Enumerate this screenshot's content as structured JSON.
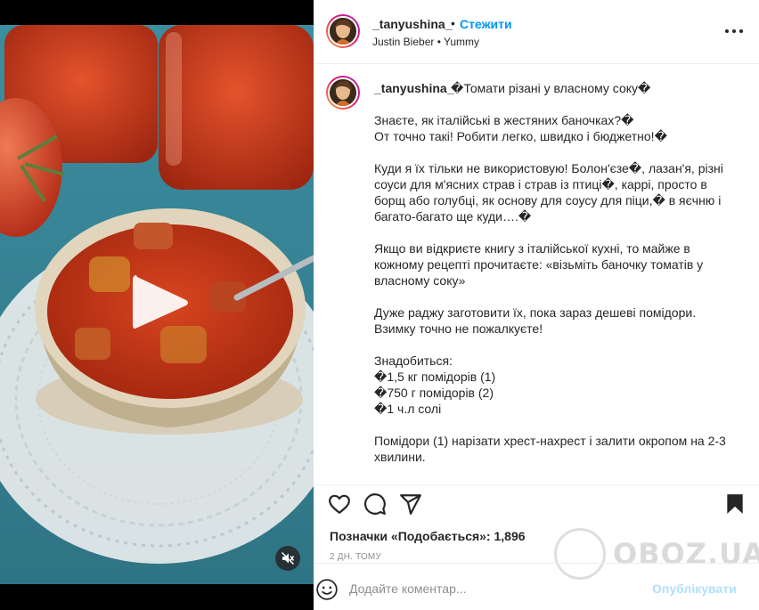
{
  "header": {
    "username": "_tanyushina_",
    "separator": "•",
    "follow_label": "Стежити",
    "audio": "Justin Bieber • Yummy",
    "more_icon": "more-horizontal-icon"
  },
  "caption": {
    "username": "_tanyushina_",
    "title": "�Томати різані у власному соку�",
    "lines": [
      "Знаєте, як італійські в жестяних баночках?�",
      "От точно такі! Робити легко, швидко і бюджетно!�",
      "",
      "Куди я їх тільки не використовую! Болон'єзе�, лазан'я, різні",
      "соуси для м'ясних страв і страв із птиці�, каррі, просто в",
      "борщ або голубці, як основу для соусу для піци,� в яєчню і",
      "багато-багато ще куди….�",
      "",
      "Якщо ви відкриєте книгу з італійської кухні, то майже в",
      "кожному рецепті прочитаєте: «візьміть баночку томатів у",
      "власному соку»",
      "",
      "Дуже раджу заготовити їх, пока зараз дешеві помідори.",
      "Взимку точно не пожалкуєте!",
      "",
      "Знадобиться:",
      "�1,5 кг помідорів (1)",
      "�750 г помідорів (2)",
      "�1 ч.л солі",
      "",
      "Помідори (1) нарізати хрест-нахрест і залити окропом на 2-3",
      "хвилини."
    ]
  },
  "actions": {
    "like_icon": "heart-icon",
    "comment_icon": "comment-icon",
    "share_icon": "send-icon",
    "save_icon": "bookmark-icon"
  },
  "likes": {
    "label": "Позначки «Подобається»:",
    "count": "1,896"
  },
  "time_ago": "2 ДН. ТОМУ",
  "comment": {
    "placeholder": "Додайте коментар...",
    "post_label": "Опублікувати"
  },
  "watermark": "OBOZ.UA",
  "colors": {
    "accent_blue": "#0095f6",
    "text": "#262626",
    "secondary_text": "#8e8e8e",
    "divider": "#efefef"
  }
}
